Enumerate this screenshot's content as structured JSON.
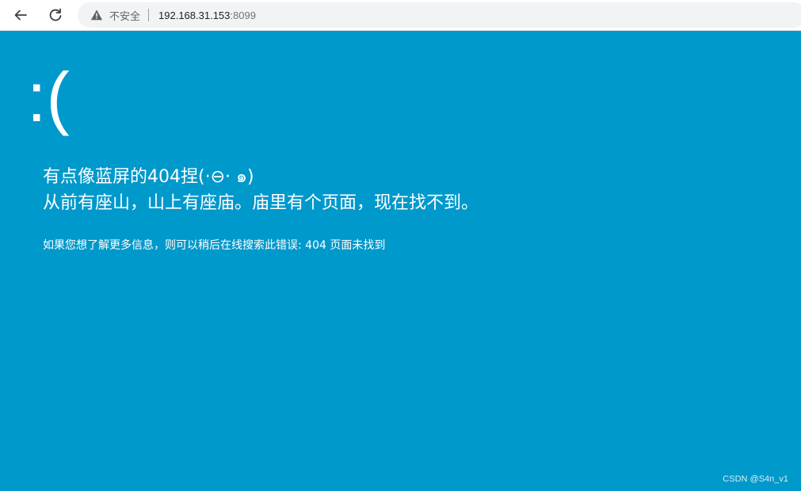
{
  "browser": {
    "back_icon": "arrow-left-icon",
    "reload_icon": "reload-icon",
    "security_icon": "warning-triangle-icon",
    "security_text": "不安全",
    "url_host": "192.168.31.153",
    "url_port": ":8099"
  },
  "page": {
    "background_color": "#0099cc",
    "sad_face": ":(",
    "line1": "有点像蓝屏的404捏(·⊖· ๑)",
    "line2": "从前有座山，山上有座庙。庙里有个页面，现在找不到。",
    "info": "如果您想了解更多信息，则可以稍后在线搜索此错误: 404 页面未找到",
    "watermark": "CSDN @S4n_v1"
  }
}
